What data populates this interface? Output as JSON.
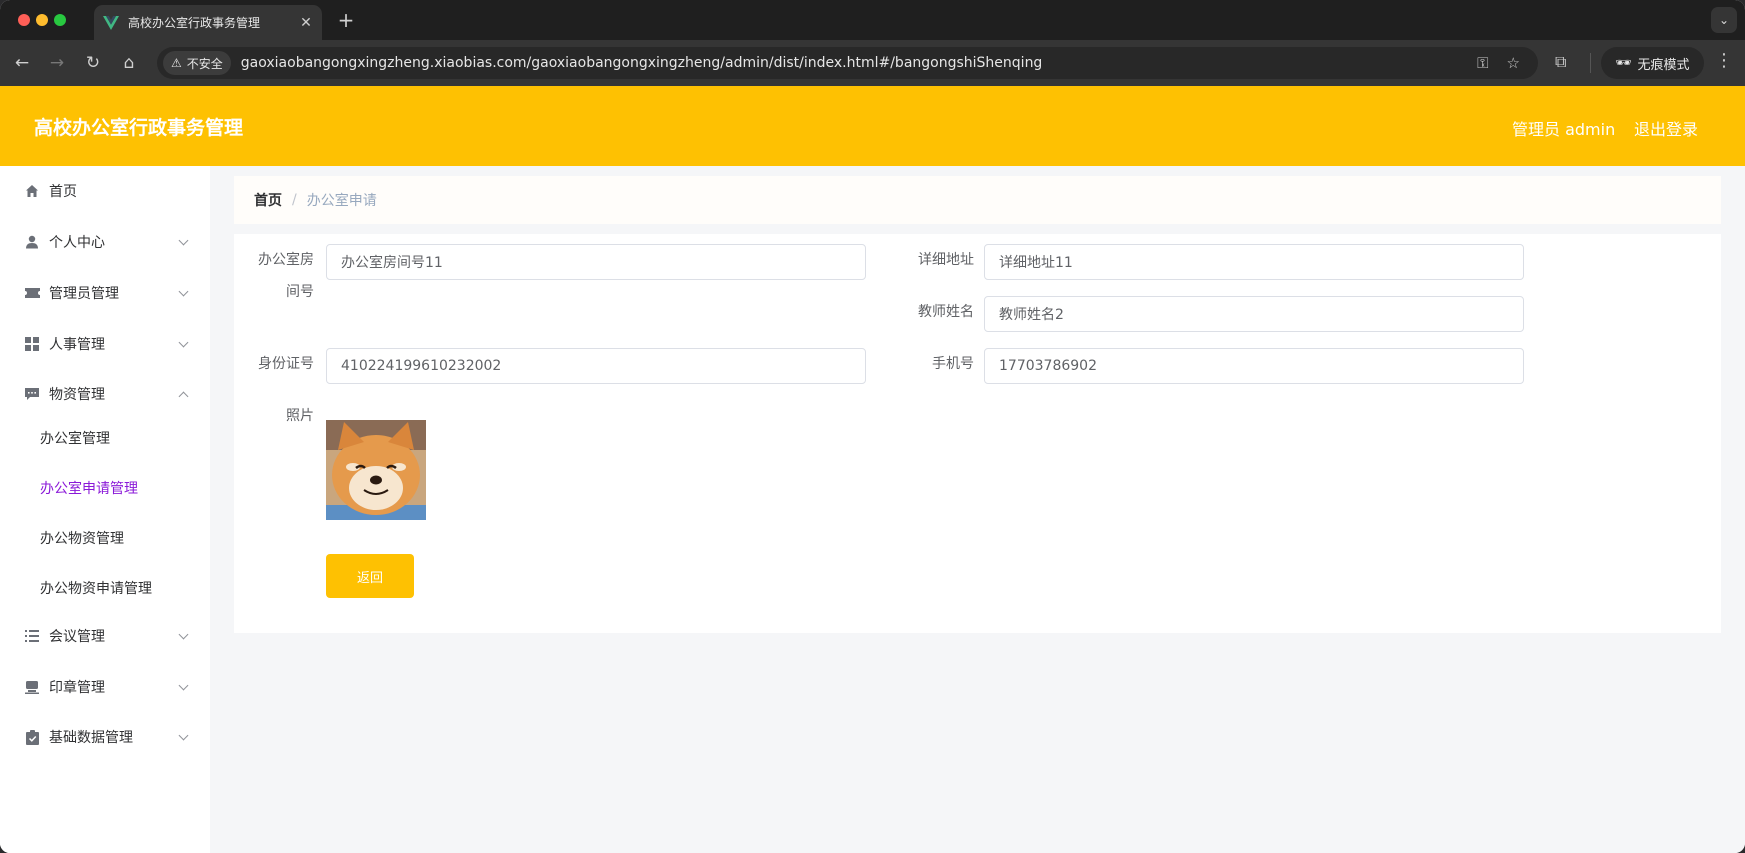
{
  "browser": {
    "tab_title": "高校办公室行政事务管理",
    "security_label": "不安全",
    "url": "gaoxiaobangongxingzheng.xiaobias.com/gaoxiaobangongxingzheng/admin/dist/index.html#/bangongshiShenqing",
    "incognito_label": "无痕模式",
    "new_tab_symbol": "+",
    "close_tab_symbol": "✕"
  },
  "header": {
    "title": "高校办公室行政事务管理",
    "user": "管理员 admin",
    "logout": "退出登录",
    "color": "#fec102"
  },
  "sidebar": {
    "items": [
      {
        "label": "首页",
        "icon": "home-icon"
      },
      {
        "label": "个人中心",
        "icon": "user-icon"
      },
      {
        "label": "管理员管理",
        "icon": "ticket-icon"
      },
      {
        "label": "人事管理",
        "icon": "grid-icon"
      },
      {
        "label": "物资管理",
        "icon": "chat-icon"
      },
      {
        "label": "会议管理",
        "icon": "list-icon"
      },
      {
        "label": "印章管理",
        "icon": "stamp-icon"
      },
      {
        "label": "基础数据管理",
        "icon": "clipboard-icon"
      }
    ],
    "subitems": [
      {
        "label": "办公室管理"
      },
      {
        "label": "办公室申请管理",
        "active": true
      },
      {
        "label": "办公物资管理"
      },
      {
        "label": "办公物资申请管理"
      }
    ],
    "active_color": "#8a19d8"
  },
  "breadcrumb": {
    "home": "首页",
    "separator": "/",
    "current": "办公室申请"
  },
  "form": {
    "room_label_line1": "办公室房",
    "room_label_line2": "间号",
    "room_value": "办公室房间号11",
    "address_label": "详细地址",
    "address_value": "详细地址11",
    "teacher_label": "教师姓名",
    "teacher_value": "教师姓名2",
    "idcard_label": "身份证号",
    "idcard_value": "410224199610232002",
    "phone_label": "手机号",
    "phone_value": "17703786902",
    "photo_label": "照片",
    "photo_icon": "shiba-dog-photo",
    "back_button": "返回"
  }
}
